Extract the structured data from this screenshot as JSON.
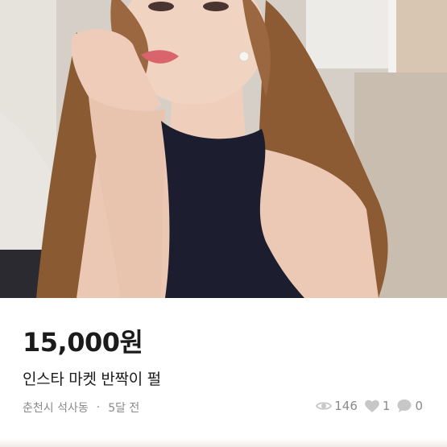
{
  "listing": {
    "price": "15,000원",
    "title": "인스타 마켓 반짝이 펄",
    "location": "춘천시 석사동",
    "separator": "·",
    "posted_ago": "5달 전",
    "views": "146",
    "likes": "1",
    "chats": "0"
  },
  "icons": {
    "views": "eye-icon",
    "likes": "heart-icon",
    "chats": "chat-bubble-icon"
  },
  "colors": {
    "text_primary": "#1b1b1b",
    "text_secondary": "#8a8a8a",
    "icon_gray": "#c7c7c7",
    "background": "#ffffff"
  }
}
